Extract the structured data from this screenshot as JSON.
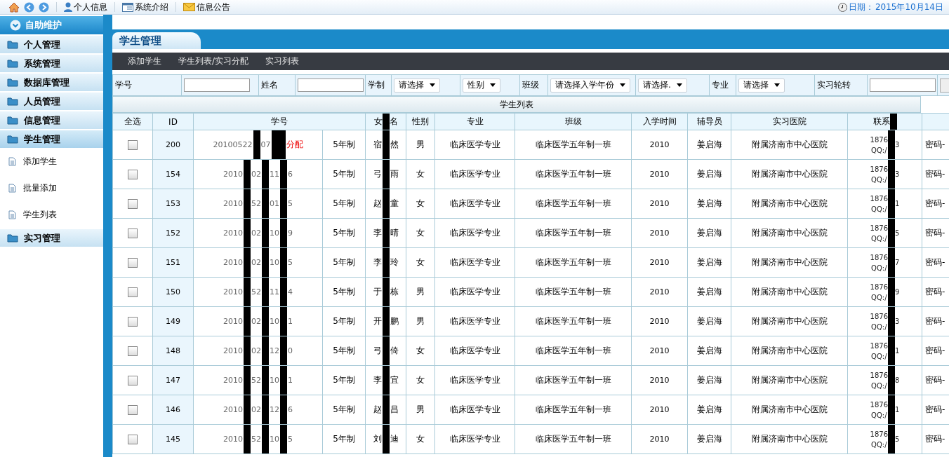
{
  "toolbar": {
    "items": [
      "个人信息",
      "系统介绍",
      "信息公告"
    ],
    "date_label": "日期：",
    "date": "2015年10月14日"
  },
  "sidebar": {
    "title": "自助维护",
    "items": [
      {
        "label": "个人管理",
        "expanded": false
      },
      {
        "label": "系统管理",
        "expanded": false
      },
      {
        "label": "数据库管理",
        "expanded": false
      },
      {
        "label": "人员管理",
        "expanded": false
      },
      {
        "label": "信息管理",
        "expanded": false
      },
      {
        "label": "学生管理",
        "expanded": true,
        "children": [
          "添加学生",
          "批量添加",
          "学生列表"
        ]
      },
      {
        "label": "实习管理",
        "expanded": false
      }
    ]
  },
  "page_tab": "学生管理",
  "nav": [
    "添加学生",
    "学生列表/实习分配",
    "实习列表"
  ],
  "filters": [
    {
      "kind": "label",
      "text": "学号"
    },
    {
      "kind": "input"
    },
    {
      "kind": "label",
      "text": "姓名"
    },
    {
      "kind": "input"
    },
    {
      "kind": "label",
      "text": "学制"
    },
    {
      "kind": "select",
      "text": "请选择"
    },
    {
      "kind": "select",
      "text": "性别"
    },
    {
      "kind": "label",
      "text": "班级"
    },
    {
      "kind": "select",
      "text": "请选择入学年份"
    },
    {
      "kind": "select",
      "text": "请选择."
    },
    {
      "kind": "label",
      "text": "专业"
    },
    {
      "kind": "select",
      "text": "请选择"
    },
    {
      "kind": "label",
      "text": "实习轮转"
    },
    {
      "kind": "input"
    },
    {
      "kind": "button"
    }
  ],
  "table": {
    "title": "学生列表",
    "columns": {
      "select_all": "全选",
      "id": "ID",
      "number": "学号",
      "name": [
        "女",
        "名"
      ],
      "gender": "性别",
      "major": "专业",
      "class": "班级",
      "year": "入学时间",
      "counselor": "辅导员",
      "hospital": "实习医院",
      "contact": "联系"
    },
    "rows": [
      {
        "checked": false,
        "id": "200",
        "number": [
          "20100522",
          "07"
        ],
        "status": "分配",
        "program": "5年制",
        "name": [
          "宿",
          "然"
        ],
        "gender": "男",
        "major": "临床医学专业",
        "class": "临床医学五年制一班",
        "year": "2010",
        "counselor": "姜启海",
        "hospital": "附属济南市中心医院",
        "phone": "1876",
        "phone_tail": "3",
        "qq": "QQ:/",
        "column_13": "密码-"
      },
      {
        "checked": false,
        "id": "154",
        "number": [
          "2010",
          "02",
          "11",
          "6"
        ],
        "program": "5年制",
        "name": [
          "弓",
          "雨"
        ],
        "gender": "女",
        "major": "临床医学专业",
        "class": "临床医学五年制一班",
        "year": "2010",
        "counselor": "姜启海",
        "hospital": "附属济南市中心医院",
        "phone": "1876",
        "phone_tail": "3",
        "qq": "QQ:/",
        "column_13": "密码-"
      },
      {
        "checked": false,
        "id": "153",
        "number": [
          "2010",
          "52",
          "01",
          "5"
        ],
        "program": "5年制",
        "name": [
          "赵",
          "童"
        ],
        "gender": "女",
        "major": "临床医学专业",
        "class": "临床医学五年制一班",
        "year": "2010",
        "counselor": "姜启海",
        "hospital": "附属济南市中心医院",
        "phone": "1876",
        "phone_tail": "1",
        "qq": "QQ:/",
        "column_13": "密码-"
      },
      {
        "checked": false,
        "id": "152",
        "number": [
          "2010",
          "02",
          "10",
          "9"
        ],
        "program": "5年制",
        "name": [
          "李",
          "晴"
        ],
        "gender": "女",
        "major": "临床医学专业",
        "class": "临床医学五年制一班",
        "year": "2010",
        "counselor": "姜启海",
        "hospital": "附属济南市中心医院",
        "phone": "1876",
        "phone_tail": "5",
        "qq": "QQ:/",
        "column_13": "密码-"
      },
      {
        "checked": false,
        "id": "151",
        "number": [
          "2010",
          "02",
          "10",
          "5"
        ],
        "program": "5年制",
        "name": [
          "李",
          "玲"
        ],
        "gender": "女",
        "major": "临床医学专业",
        "class": "临床医学五年制一班",
        "year": "2010",
        "counselor": "姜启海",
        "hospital": "附属济南市中心医院",
        "phone": "1876",
        "phone_tail": "7",
        "qq": "QQ:/",
        "column_13": "密码-"
      },
      {
        "checked": false,
        "id": "150",
        "number": [
          "2010",
          "52",
          "11",
          "4"
        ],
        "program": "5年制",
        "name": [
          "于",
          "栋"
        ],
        "gender": "男",
        "major": "临床医学专业",
        "class": "临床医学五年制一班",
        "year": "2010",
        "counselor": "姜启海",
        "hospital": "附属济南市中心医院",
        "phone": "1876",
        "phone_tail": "9",
        "qq": "QQ:/",
        "column_13": "密码-"
      },
      {
        "checked": false,
        "id": "149",
        "number": [
          "2010",
          "02",
          "10",
          "1"
        ],
        "program": "5年制",
        "name": [
          "开",
          "鹏"
        ],
        "gender": "男",
        "major": "临床医学专业",
        "class": "临床医学五年制一班",
        "year": "2010",
        "counselor": "姜启海",
        "hospital": "附属济南市中心医院",
        "phone": "1876",
        "phone_tail": "3",
        "qq": "QQ:/",
        "column_13": "密码-"
      },
      {
        "checked": false,
        "id": "148",
        "number": [
          "2010",
          "02",
          "12",
          "0"
        ],
        "program": "5年制",
        "name": [
          "弓",
          "倚"
        ],
        "gender": "女",
        "major": "临床医学专业",
        "class": "临床医学五年制一班",
        "year": "2010",
        "counselor": "姜启海",
        "hospital": "附属济南市中心医院",
        "phone": "1876",
        "phone_tail": "1",
        "qq": "QQ:/",
        "column_13": "密码-"
      },
      {
        "checked": false,
        "id": "147",
        "number": [
          "2010",
          "52",
          "10",
          "1"
        ],
        "program": "5年制",
        "name": [
          "李",
          "宜"
        ],
        "gender": "女",
        "major": "临床医学专业",
        "class": "临床医学五年制一班",
        "year": "2010",
        "counselor": "姜启海",
        "hospital": "附属济南市中心医院",
        "phone": "1876",
        "phone_tail": "8",
        "qq": "QQ:/",
        "column_13": "密码-"
      },
      {
        "checked": false,
        "id": "146",
        "number": [
          "2010",
          "02",
          "12",
          "6"
        ],
        "program": "5年制",
        "name": [
          "赵",
          "昌"
        ],
        "gender": "男",
        "major": "临床医学专业",
        "class": "临床医学五年制一班",
        "year": "2010",
        "counselor": "姜启海",
        "hospital": "附属济南市中心医院",
        "phone": "1876",
        "phone_tail": "1",
        "qq": "QQ:/",
        "column_13": "密码-"
      },
      {
        "checked": false,
        "id": "145",
        "number": [
          "2010",
          "52",
          "10",
          "5"
        ],
        "program": "5年制",
        "name": [
          "刘",
          "迪"
        ],
        "gender": "女",
        "major": "临床医学专业",
        "class": "临床医学五年制一班",
        "year": "2010",
        "counselor": "姜启海",
        "hospital": "附属济南市中心医院",
        "phone": "1876",
        "phone_tail": "5",
        "qq": "QQ:/",
        "column_13": "密码-"
      }
    ]
  }
}
